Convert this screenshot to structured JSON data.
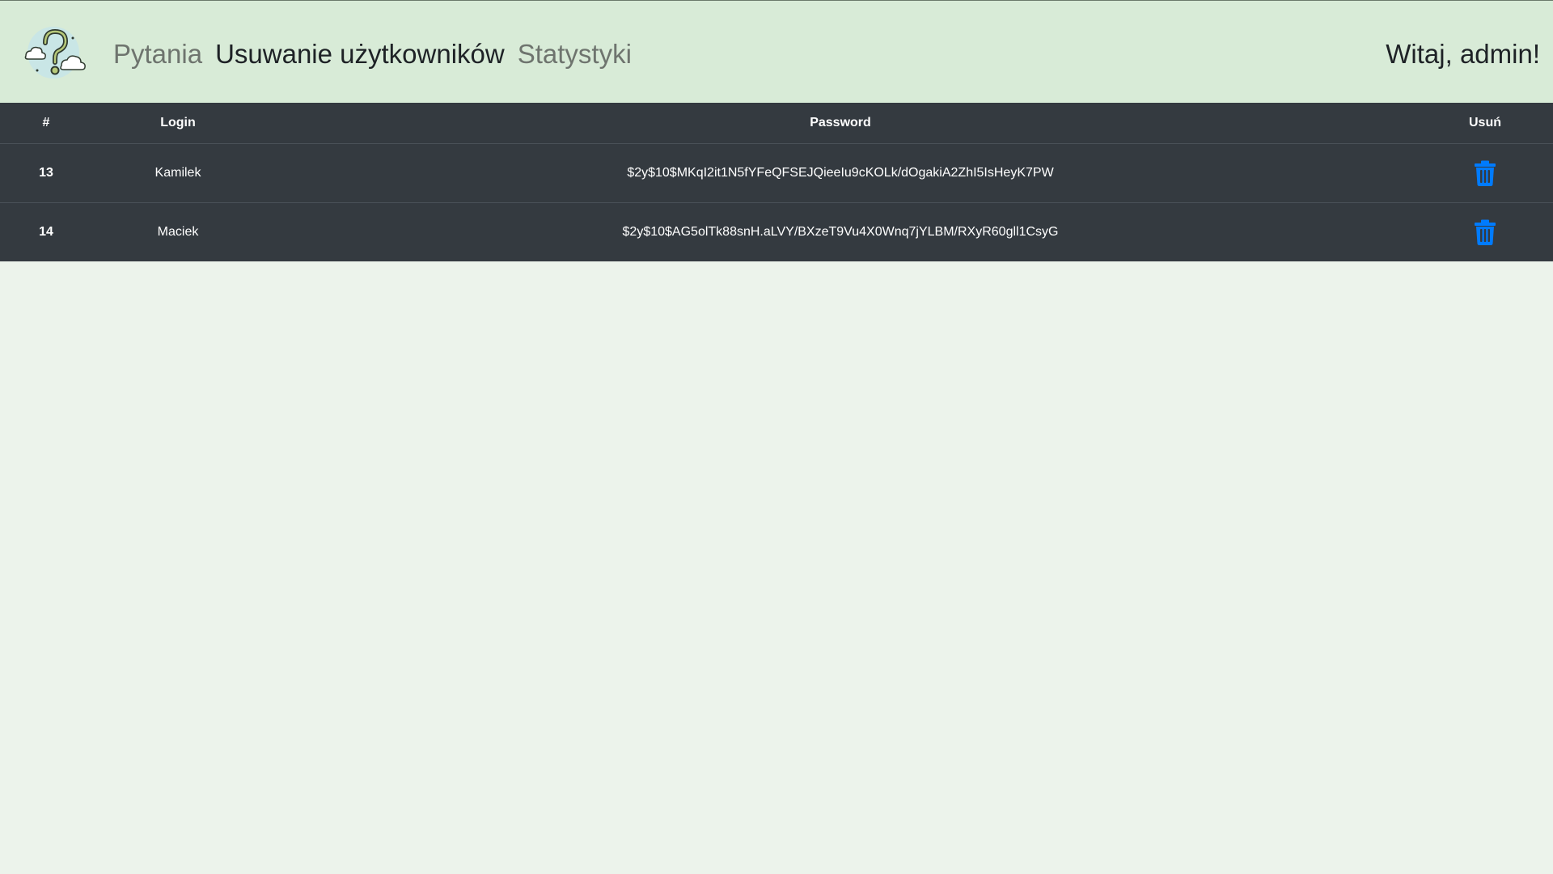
{
  "navbar": {
    "links": [
      {
        "label": "Pytania",
        "active": false
      },
      {
        "label": "Usuwanie użytkowników",
        "active": true
      },
      {
        "label": "Statystyki",
        "active": false
      }
    ],
    "greeting": "Witaj, admin!",
    "logo_icon": "question-mark-clouds-icon"
  },
  "table": {
    "headers": {
      "id": "#",
      "login": "Login",
      "password": "Password",
      "delete": "Usuń"
    },
    "rows": [
      {
        "id": "13",
        "login": "Kamilek",
        "password": "$2y$10$MKqI2it1N5fYFeQFSEJQieeIu9cKOLk/dOgakiA2ZhI5IsHeyK7PW"
      },
      {
        "id": "14",
        "login": "Maciek",
        "password": "$2y$10$AG5olTk88snH.aLVY/BXzeT9Vu4X0Wnq7jYLBM/RXyR60gll1CsyG"
      }
    ],
    "delete_icon": "trash-icon"
  },
  "colors": {
    "navbar_bg": "#d8ebd7",
    "page_bg": "#ecf3eb",
    "table_bg": "#343a40",
    "delete_icon": "#007bff"
  }
}
